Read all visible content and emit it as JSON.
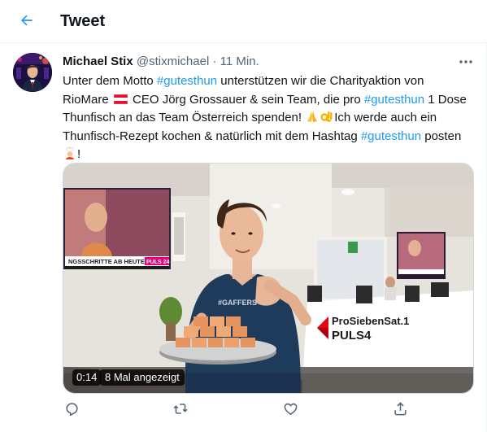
{
  "header": {
    "title": "Tweet",
    "back_icon": "arrow-left-icon"
  },
  "tweet": {
    "author_name": "Michael Stix",
    "handle": "@stixmichael",
    "separator": "·",
    "time": "11 Min.",
    "text_parts": {
      "l1_a": "Unter dem Motto ",
      "l1_tag": "#gutesthun",
      "l1_b": " unterstützen wir die Charityaktion von",
      "l2_a": "RioMare ",
      "l2_b": " CEO Jörg Grossauer & sein Team, die pro ",
      "l2_tag": "#gutesthun",
      "l2_c": " 1 Dose",
      "l3_a": "Thunfisch an das Team Österreich spenden! ",
      "l3_b": "Ich werde auch ein",
      "l4_a": "Thunfisch-Rezept kochen & natürlich mit dem Hashtag ",
      "l4_tag": "#gutesthun",
      "l4_b": " posten",
      "l5_a": "!"
    },
    "emojis": [
      "austria-flag-icon",
      "folded-hands-emoji",
      "ok-hand-emoji",
      "cook-emoji"
    ],
    "video": {
      "duration": "0:14",
      "views": "8 Mal angezeigt",
      "tv_ticker": "NGSSCHRITTE AB HEUTE",
      "tv_brand": "PULS 24",
      "shirt_text": "#GAFFERS",
      "wall_logo_line1": "ProSiebenSat.1",
      "wall_logo_line2": "PULS4"
    },
    "actions": [
      "reply-icon",
      "retweet-icon",
      "like-icon",
      "share-icon"
    ]
  },
  "colors": {
    "accent": "#1d9bf0",
    "text": "#0f1419",
    "muted": "#536471",
    "border": "#eff3f4"
  }
}
